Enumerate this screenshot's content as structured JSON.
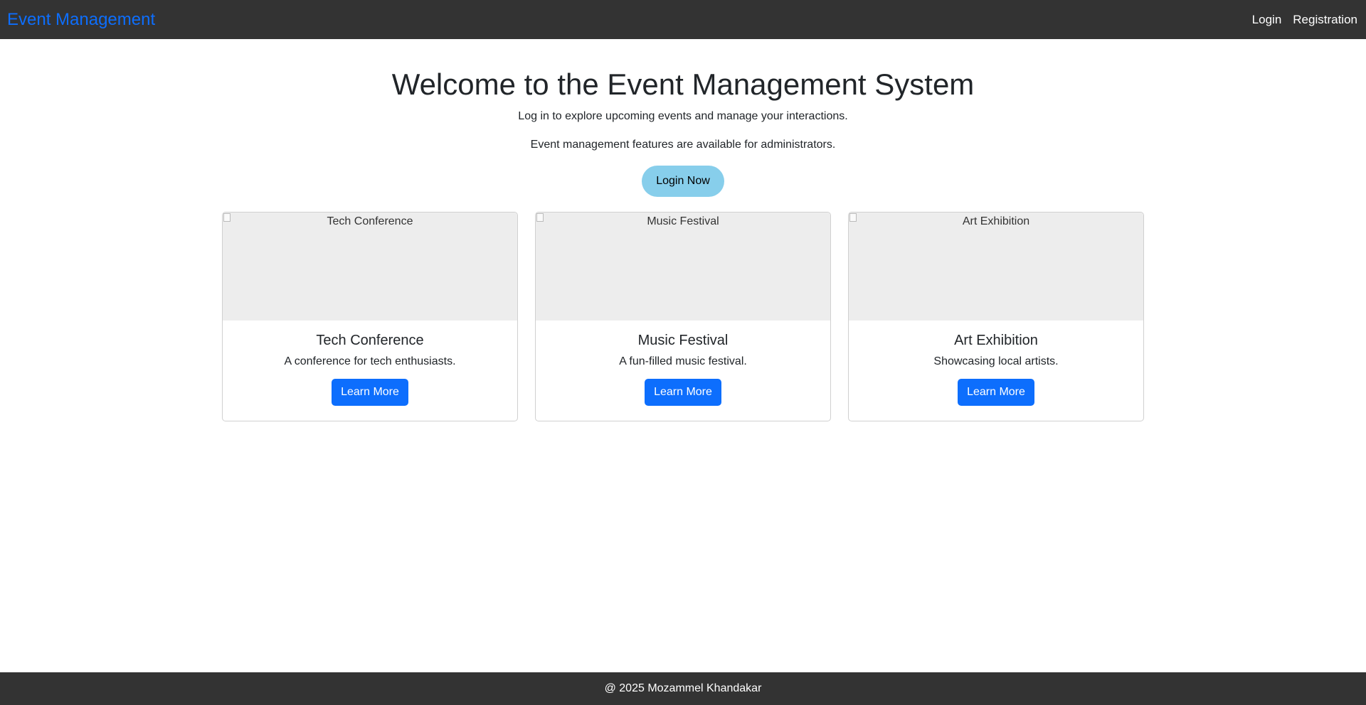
{
  "navbar": {
    "brand": "Event Management",
    "links": [
      "Login",
      "Registration"
    ]
  },
  "hero": {
    "title": "Welcome to the Event Management System",
    "subtitle": "Log in to explore upcoming events and manage your interactions.",
    "admin_note": "Event management features are available for administrators.",
    "login_button": "Login Now"
  },
  "events": [
    {
      "image_alt": "Tech Conference",
      "title": "Tech Conference",
      "description": "A conference for tech enthusiasts.",
      "button": "Learn More"
    },
    {
      "image_alt": "Music Festival",
      "title": "Music Festival",
      "description": "A fun-filled music festival.",
      "button": "Learn More"
    },
    {
      "image_alt": "Art Exhibition",
      "title": "Art Exhibition",
      "description": "Showcasing local artists.",
      "button": "Learn More"
    }
  ],
  "footer": {
    "text": "@ 2025 Mozammel Khandakar"
  },
  "colors": {
    "navbar_bg": "#333333",
    "brand": "#0d6efd",
    "login_button_bg": "#87ceeb",
    "learn_more_bg": "#0d6efd"
  }
}
